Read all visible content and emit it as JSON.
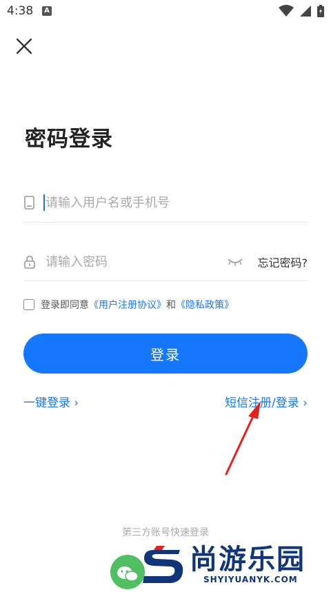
{
  "status_bar": {
    "time": "4:38",
    "notification_badge": "A"
  },
  "page": {
    "title": "密码登录"
  },
  "form": {
    "username_placeholder": "请输入用户名或手机号",
    "password_placeholder": "请输入密码",
    "forgot_password": "忘记密码?"
  },
  "agreement": {
    "prefix": "登录即同意",
    "user_agreement": "《用户注册协议》",
    "and": "和",
    "privacy_policy": "《隐私政策》"
  },
  "login_button": "登录",
  "links": {
    "one_click_login": "一键登录 ›",
    "sms_register_login": "短信注册/登录 ›"
  },
  "third_party": {
    "label": "第三方账号快速登录"
  },
  "watermark": {
    "title": "尚游乐园",
    "subtitle": "SHYIYUANYK.COM"
  },
  "colors": {
    "accent": "#1677ff",
    "annotation_arrow": "#e8201c",
    "wechat": "#4fbf61"
  }
}
